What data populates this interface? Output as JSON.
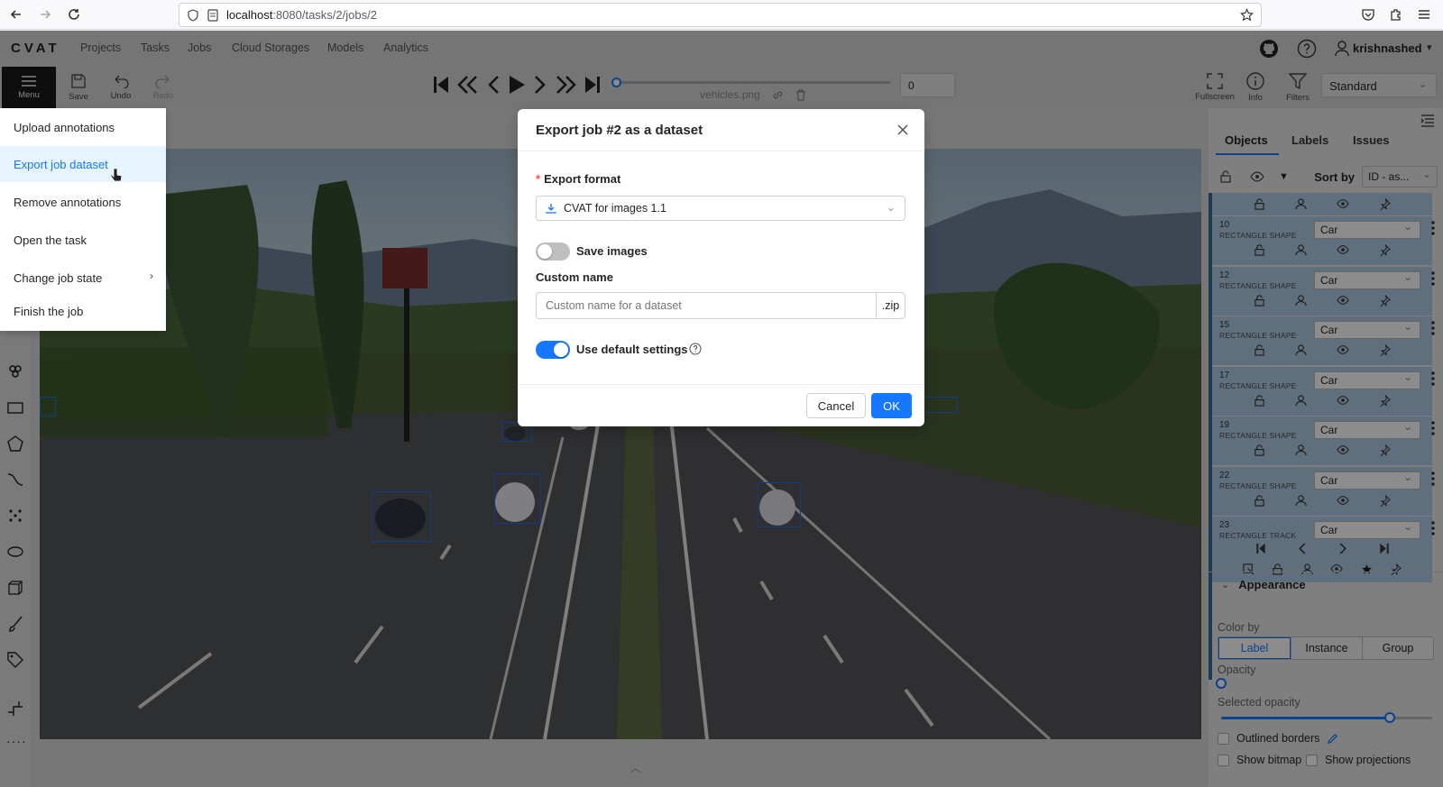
{
  "browser": {
    "url_host": "localhost",
    "url_path": ":8080/tasks/2/jobs/2"
  },
  "app": {
    "logo": "CVAT",
    "nav": [
      "Projects",
      "Tasks",
      "Jobs",
      "Cloud Storages",
      "Models",
      "Analytics"
    ],
    "username": "krishnashed"
  },
  "toolbar": {
    "menu": "Menu",
    "save": "Save",
    "undo": "Undo",
    "redo": "Redo",
    "filename": "vehicles.png",
    "frame_value": "0",
    "fullscreen": "Fullscreen",
    "info": "Info",
    "filters": "Filters",
    "workspace_mode": "Standard"
  },
  "menu": {
    "items": [
      "Upload annotations",
      "Export job dataset",
      "Remove annotations",
      "Open the task",
      "Change job state",
      "Finish the job"
    ],
    "active_index": 1
  },
  "modal": {
    "title": "Export job #2 as a dataset",
    "format_label": "Export format",
    "format_value": "CVAT for images 1.1",
    "save_images_label": "Save images",
    "save_images_on": false,
    "custom_name_label": "Custom name",
    "custom_name_placeholder": "Custom name for a dataset",
    "custom_name_suffix": ".zip",
    "default_settings_label": "Use default settings",
    "default_settings_on": true,
    "cancel": "Cancel",
    "ok": "OK"
  },
  "sidebar": {
    "tabs": [
      "Objects",
      "Labels",
      "Issues"
    ],
    "sort_label": "Sort by",
    "sort_value": "ID - as...",
    "objects": [
      {
        "id": "10",
        "type": "RECTANGLE SHAPE",
        "label": "Car"
      },
      {
        "id": "12",
        "type": "RECTANGLE SHAPE",
        "label": "Car"
      },
      {
        "id": "15",
        "type": "RECTANGLE SHAPE",
        "label": "Car"
      },
      {
        "id": "17",
        "type": "RECTANGLE SHAPE",
        "label": "Car"
      },
      {
        "id": "19",
        "type": "RECTANGLE SHAPE",
        "label": "Car"
      },
      {
        "id": "22",
        "type": "RECTANGLE SHAPE",
        "label": "Car"
      },
      {
        "id": "23",
        "type": "RECTANGLE TRACK",
        "label": "Car"
      }
    ],
    "appearance": {
      "title": "Appearance",
      "color_by_label": "Color by",
      "color_by_options": [
        "Label",
        "Instance",
        "Group"
      ],
      "opacity_label": "Opacity",
      "opacity_value": 0,
      "selected_opacity_label": "Selected opacity",
      "selected_opacity_value": 0.8,
      "outlined_borders": "Outlined borders",
      "show_bitmap": "Show bitmap",
      "show_projections": "Show projections"
    }
  },
  "colors": {
    "accent": "#1677ff",
    "object_card": "#aecbe4",
    "bbox": "#1a6cff"
  }
}
